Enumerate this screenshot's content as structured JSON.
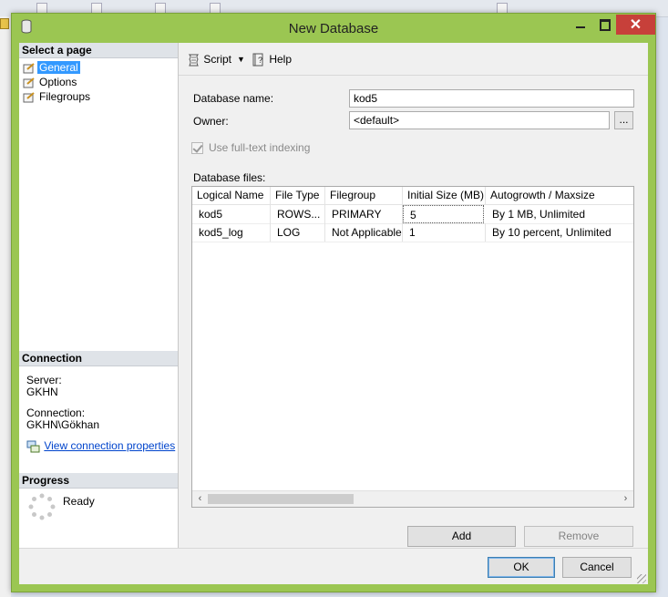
{
  "window": {
    "title": "New Database"
  },
  "left_pane": {
    "select_page_header": "Select a page",
    "pages": [
      {
        "label": "General",
        "selected": true
      },
      {
        "label": "Options",
        "selected": false
      },
      {
        "label": "Filegroups",
        "selected": false
      }
    ],
    "connection_header": "Connection",
    "server_label": "Server:",
    "server_value": "GKHN",
    "connection_label": "Connection:",
    "connection_value": "GKHN\\Gökhan",
    "view_connection_link": "View connection properties",
    "progress_header": "Progress",
    "progress_status": "Ready"
  },
  "toolbar": {
    "script_label": "Script",
    "help_label": "Help"
  },
  "form": {
    "database_name_label": "Database name:",
    "database_name_value": "kod5",
    "owner_label": "Owner:",
    "owner_value": "<default>",
    "owner_browse_label": "...",
    "fulltext_label": "Use full-text indexing",
    "fulltext_checked": true,
    "database_files_label": "Database files:"
  },
  "files_table": {
    "columns": [
      "Logical Name",
      "File Type",
      "Filegroup",
      "Initial Size (MB)",
      "Autogrowth / Maxsize"
    ],
    "rows": [
      [
        "kod5",
        "ROWS...",
        "PRIMARY",
        "5",
        "By 1 MB, Unlimited"
      ],
      [
        "kod5_log",
        "LOG",
        "Not Applicable",
        "1",
        "By 10 percent, Unlimited"
      ]
    ]
  },
  "buttons": {
    "add": "Add",
    "remove": "Remove",
    "ok": "OK",
    "cancel": "Cancel"
  },
  "colors": {
    "frame": "#9bc652",
    "close": "#c7403a",
    "selection": "#3399ff",
    "link": "#0044cc"
  }
}
